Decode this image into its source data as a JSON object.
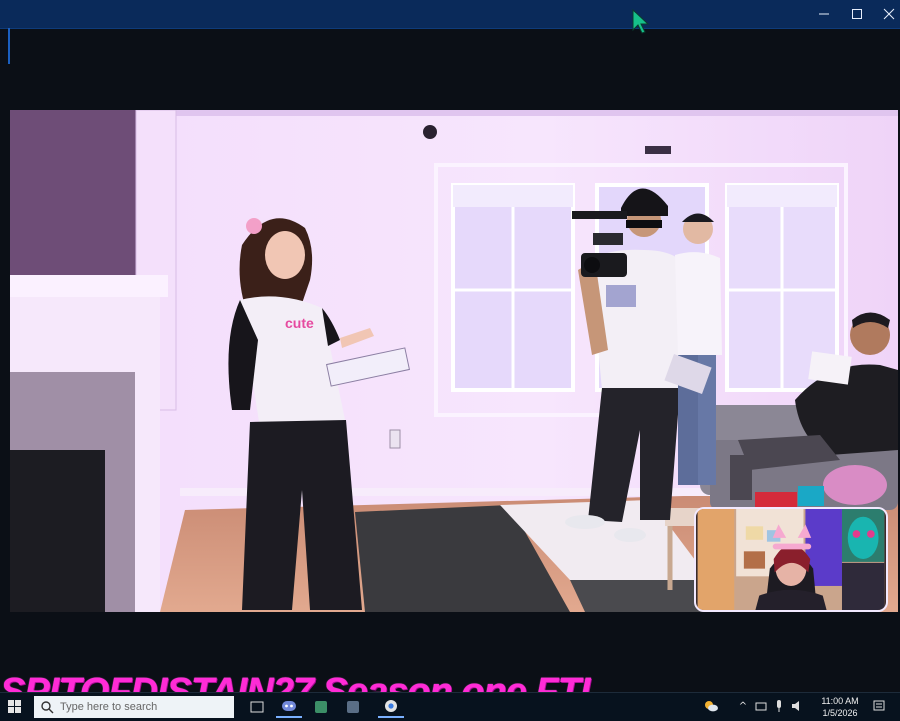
{
  "window": {
    "controls": {
      "minimize_icon": "minimize-icon",
      "maximize_icon": "maximize-icon",
      "close_icon": "close-icon"
    }
  },
  "video": {
    "scene": "film-set-living-room",
    "webcam_overlay": "streamer-webcam"
  },
  "overlay": {
    "caption": "SPITOFDISTAIN27 Season one FTL"
  },
  "taskbar": {
    "search_placeholder": "Type here to search",
    "pinned_apps": [
      "discord-icon",
      "app-icon",
      "app-icon",
      "chrome-icon"
    ],
    "clock": {
      "time": "11:00 AM",
      "date": "1/5/2026"
    }
  },
  "colors": {
    "titlebar": "#0a2a5a",
    "overlay_text": "#ff2bd6",
    "taskbar": "#07121e"
  }
}
